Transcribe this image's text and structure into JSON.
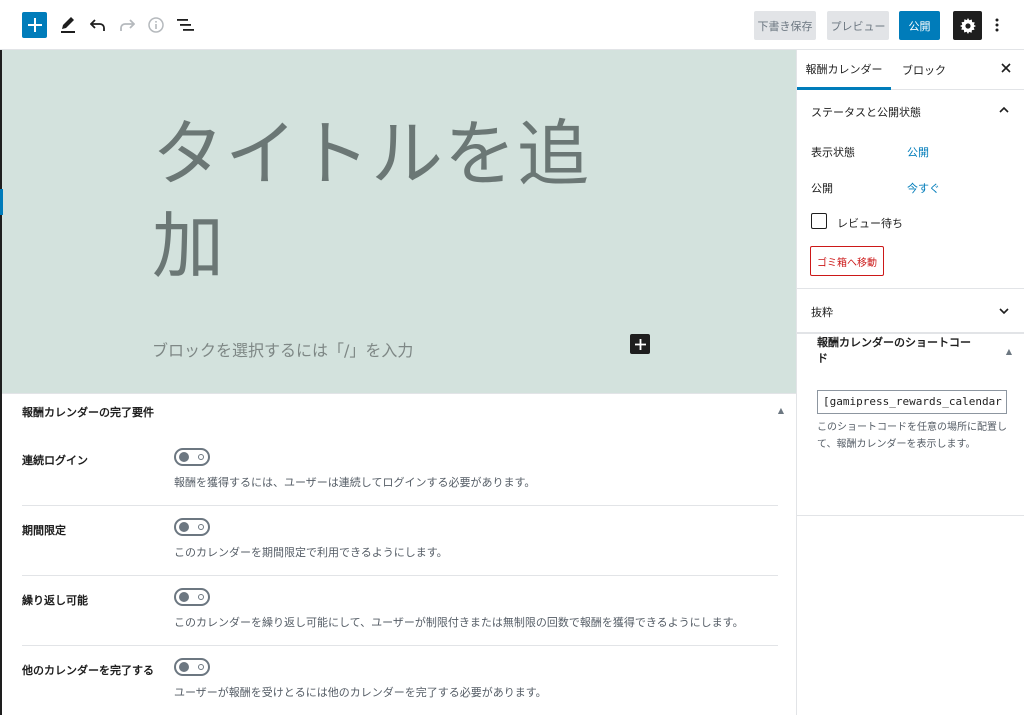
{
  "toolbar": {
    "add_icon": "plus-icon",
    "tools_icon": "pencil-icon",
    "undo_icon": "undo-icon",
    "redo_icon": "redo-icon",
    "info_icon": "info-icon",
    "outline_icon": "list-view-icon",
    "save_draft": "下書き保存",
    "preview": "プレビュー",
    "publish": "公開",
    "settings_icon": "gear-icon",
    "more_icon": "more-vertical-icon"
  },
  "canvas": {
    "title_placeholder": "タイトルを追加",
    "block_placeholder": "ブロックを選択するには「/」を入力",
    "block_add_icon": "plus-icon"
  },
  "metabox": {
    "title": "報酬カレンダーの完了要件",
    "toggle_icon": "triangle-up-icon",
    "requirements": [
      {
        "label": "連続ログイン",
        "description": "報酬を獲得するには、ユーザーは連続してログインする必要があります。",
        "enabled": false
      },
      {
        "label": "期間限定",
        "description": "このカレンダーを期間限定で利用できるようにします。",
        "enabled": false
      },
      {
        "label": "繰り返し可能",
        "description": "このカレンダーを繰り返し可能にして、ユーザーが制限付きまたは無制限の回数で報酬を獲得できるようにします。",
        "enabled": false
      },
      {
        "label": "他のカレンダーを完了する",
        "description": "ユーザーが報酬を受けとるには他のカレンダーを完了する必要があります。",
        "enabled": false
      }
    ]
  },
  "sidebar": {
    "tabs": [
      {
        "label": "報酬カレンダー",
        "active": true
      },
      {
        "label": "ブロック",
        "active": false
      }
    ],
    "close_icon": "close-icon",
    "status_panel": {
      "title": "ステータスと公開状態",
      "visibility_label": "表示状態",
      "visibility_value": "公開",
      "publish_label": "公開",
      "publish_value": "今すぐ",
      "pending_review_label": "レビュー待ち",
      "trash_label": "ゴミ箱へ移動"
    },
    "excerpt_panel": {
      "title": "抜粋"
    },
    "shortcode_panel": {
      "title": "報酬カレンダーのショートコード",
      "value": "[gamipress_rewards_calendar id=",
      "description": "このショートコードを任意の場所に配置して、報酬カレンダーを表示します。"
    }
  },
  "colors": {
    "accent": "#007cba",
    "canvas_bg": "#d3e2dd",
    "danger": "#cc1818"
  }
}
